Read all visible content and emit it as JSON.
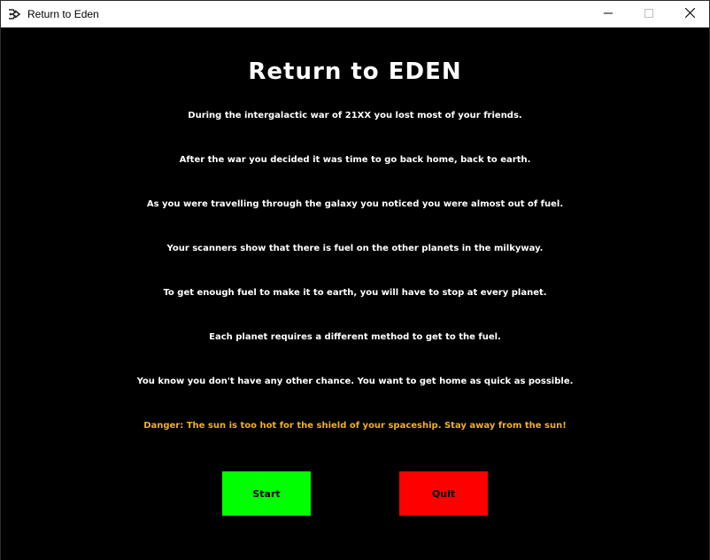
{
  "window": {
    "title": "Return to Eden",
    "icon": "pygame-snake-icon",
    "controls": {
      "minimize_icon": "minimize-icon",
      "maximize_icon": "maximize-icon",
      "close_icon": "close-icon"
    }
  },
  "game": {
    "title": "Return to EDEN",
    "story": [
      "During the intergalactic war of 21XX you lost most of your friends.",
      "After the war you decided it was time to go back home, back to earth.",
      "As you were travelling through the galaxy you noticed you were almost out of fuel.",
      "Your scanners show that there is fuel on the other planets in the milkyway.",
      "To get enough fuel to make it to earth, you will have to stop at every planet.",
      "Each planet requires a different method to get to the fuel.",
      "You know you don't have any other chance. You want to get home as quick as possible."
    ],
    "danger": "Danger: The sun is too hot for the shield of your spaceship. Stay away from the sun!",
    "buttons": {
      "start_label": "Start",
      "quit_label": "Quit"
    }
  },
  "colors": {
    "background": "#000000",
    "text": "#ffffff",
    "danger_text": "#f0b020",
    "start_button": "#00ff00",
    "quit_button": "#ff0000"
  }
}
